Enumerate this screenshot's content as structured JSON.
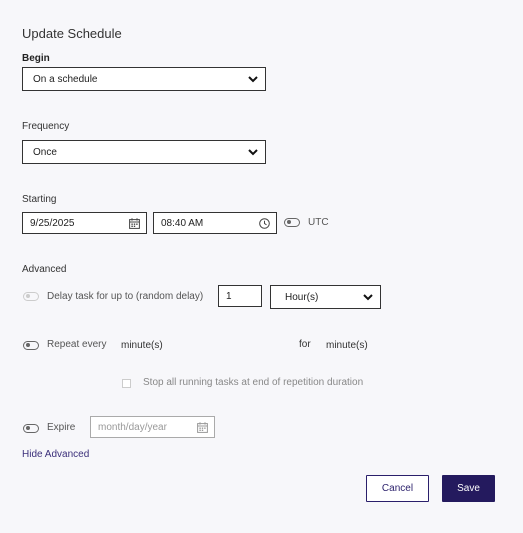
{
  "dialog": {
    "title": "Update Schedule",
    "begin": {
      "label": "Begin",
      "value": "On a schedule"
    },
    "frequency": {
      "label": "Frequency",
      "value": "Once"
    },
    "starting": {
      "label": "Starting",
      "date": "9/25/2025",
      "time": "08:40 AM",
      "utc_label": "UTC",
      "utc_enabled": false
    },
    "advanced": {
      "label": "Advanced",
      "delay": {
        "label": "Delay task for up to (random delay)",
        "amount": "1",
        "unit": "Hour(s)",
        "enabled": false
      },
      "repeat": {
        "label": "Repeat every",
        "unit1": "minute(s)",
        "for_label": "for",
        "unit2": "minute(s)",
        "enabled": false
      },
      "stop_all_label": "Stop all running tasks at end of repetition duration",
      "stop_all_checked": false,
      "expire": {
        "label": "Expire",
        "placeholder": "month/day/year",
        "enabled": false
      }
    },
    "hide_advanced_label": "Hide Advanced",
    "cancel_label": "Cancel",
    "save_label": "Save"
  },
  "colors": {
    "primary": "#241a5e",
    "background": "#f7f7fa",
    "link": "#3b2f7a"
  },
  "icons": [
    "chevron-down-icon",
    "calendar-icon",
    "clock-icon"
  ]
}
